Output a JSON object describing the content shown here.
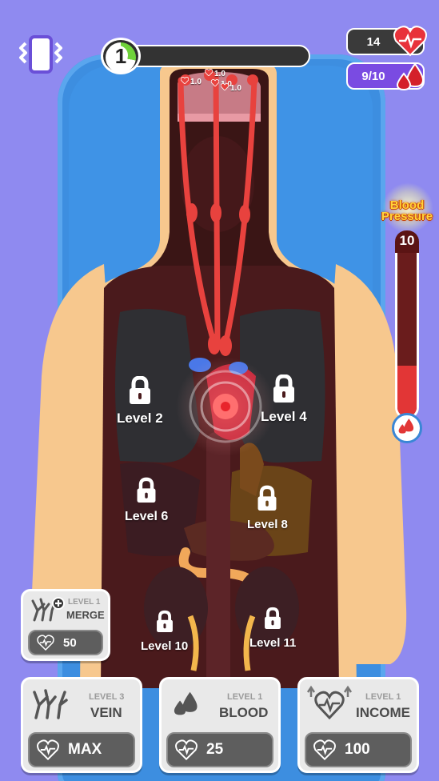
{
  "hud": {
    "level_number": "1",
    "level_progress_pct": 28,
    "hearts_count": "14",
    "blood_count": "9/10"
  },
  "blood_pressure": {
    "title_line1": "Blood",
    "title_line2": "Pressure",
    "value": "10",
    "fill_fraction": 0.28
  },
  "veins": {
    "tags": [
      "1.0",
      "1.0",
      "1.0",
      "1.0"
    ]
  },
  "locked_levels": [
    {
      "label": "Level 2"
    },
    {
      "label": "Level 4"
    },
    {
      "label": "Level 6"
    },
    {
      "label": "Level 8"
    },
    {
      "label": "Level 10"
    },
    {
      "label": "Level 11"
    }
  ],
  "merge_card": {
    "level": "LEVEL 1",
    "title": "MERGE",
    "cost": "50"
  },
  "upgrade_cards": [
    {
      "level": "LEVEL 3",
      "title": "VEIN",
      "cost": "MAX",
      "icon": "vein-icon"
    },
    {
      "level": "LEVEL 1",
      "title": "BLOOD",
      "cost": "25",
      "icon": "blood-drops-icon"
    },
    {
      "level": "LEVEL 1",
      "title": "INCOME",
      "cost": "100",
      "icon": "heart-income-icon"
    }
  ],
  "colors": {
    "background": "#8f8af0",
    "bed": "#3d8ee0",
    "skin": "#f7c88e",
    "body_cavity": "#4a1a1c",
    "vein": "#e8423e",
    "blood_stat": "#7a4be2",
    "bp_fill": "#e23636"
  }
}
